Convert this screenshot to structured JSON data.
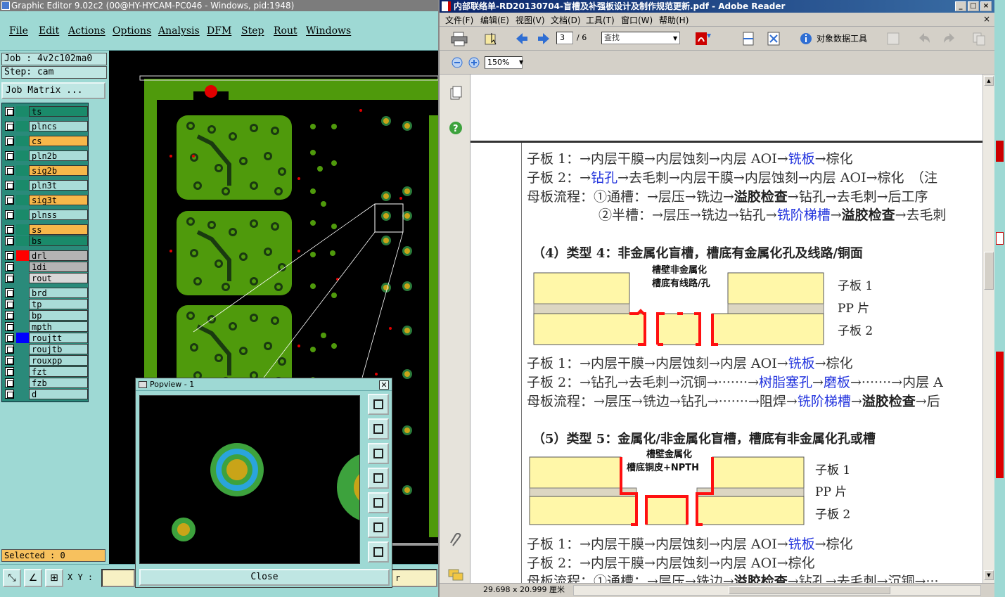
{
  "ge": {
    "title": "Graphic Editor 9.02c2 (00@HY-HYCAM-PC046 - Windows, pid:1948)",
    "menu": [
      "File",
      "Edit",
      "Actions",
      "Options",
      "Analysis",
      "DFM",
      "Step",
      "Rout",
      "Windows"
    ],
    "job_label": "Job : 4v2c102ma0",
    "step_label": "Step: cam",
    "job_matrix_label": "Job Matrix ...",
    "layers": [
      {
        "name": "ts",
        "color": "#1a8a6a"
      },
      {
        "name": "plncs",
        "color": "#a9dcd8"
      },
      {
        "name": "cs",
        "color": "#f7b74a"
      },
      {
        "name": "pln2b",
        "color": "#a9dcd8"
      },
      {
        "name": "sig2b",
        "color": "#f7b74a"
      },
      {
        "name": "pln3t",
        "color": "#a9dcd8"
      },
      {
        "name": "sig3t",
        "color": "#f7b74a"
      },
      {
        "name": "plnss",
        "color": "#a9dcd8"
      },
      {
        "name": "ss",
        "color": "#f7b74a"
      },
      {
        "name": "bs",
        "color": "#1a8a6a"
      },
      {
        "name": "drl",
        "color": "#b4b4b4"
      },
      {
        "name": "1di",
        "color": "#b4b4b4"
      },
      {
        "name": "rout",
        "color": "#d8d8d8"
      },
      {
        "name": "brd",
        "color": "#a9dcd8"
      },
      {
        "name": "tp",
        "color": "#a9dcd8"
      },
      {
        "name": "bp",
        "color": "#a9dcd8"
      },
      {
        "name": "mpth",
        "color": "#a9dcd8"
      },
      {
        "name": "roujtt",
        "color": "#a9dcd8"
      },
      {
        "name": "roujtb",
        "color": "#a9dcd8"
      },
      {
        "name": "rouxpp",
        "color": "#a9dcd8"
      },
      {
        "name": "fzt",
        "color": "#a9dcd8"
      },
      {
        "name": "fzb",
        "color": "#a9dcd8"
      },
      {
        "name": "d",
        "color": "#a9dcd8"
      }
    ],
    "selected_label": "Selected : 0",
    "xy_label": "X Y :",
    "xy_right": "r",
    "popview": {
      "title": "Popview - 1",
      "close_label": "Close",
      "close_x": "✕"
    }
  },
  "ar": {
    "title": "内部联络单-RD20130704-盲槽及补强板设计及制作规范更新.pdf - Adobe Reader",
    "menu": [
      "文件(F)",
      "编辑(E)",
      "视图(V)",
      "文档(D)",
      "工具(T)",
      "窗口(W)",
      "帮助(H)"
    ],
    "page_current": "3",
    "page_total": "/ 6",
    "find_placeholder": "查找",
    "object_tool": "对象数据工具",
    "zoom": "150%",
    "status_size": "29.698 x 20.999 厘米",
    "doc": {
      "s1": {
        "a": "子板 1：→内层干膜→内层蚀刻→内层 AOI→",
        "b": "铣板",
        "c": "→棕化"
      },
      "s2": {
        "a": "子板 2：→",
        "b": "钻孔",
        "c": "→去毛刺→内层干膜→内层蚀刻→内层 AOI→棕化　（注"
      },
      "s3": {
        "a": "母板流程：①通槽：→层压→铣边→",
        "b": "溢胶检查",
        "c": "→钻孔→去毛刺→后工序"
      },
      "s4": {
        "a": "②半槽：→层压→铣边→钻孔→",
        "b": "铣阶梯槽",
        "c": "→",
        "d": "溢胶检查",
        "e": "→去毛刺"
      },
      "h4": "（4）类型 4：非金属化盲槽，槽底有金属化孔及线路/铜面",
      "d4_note": [
        "槽壁非金属化",
        "槽底有线路/孔"
      ],
      "d4_labels": [
        "子板 1",
        "PP 片",
        "子板 2"
      ],
      "t1": {
        "a": "子板 1：→内层干膜→内层蚀刻→内层 AOI→",
        "b": "铣板",
        "c": "→棕化"
      },
      "t2": {
        "a": "子板 2：→钻孔→去毛刺→沉铜→·······→",
        "b": "树脂塞孔",
        "c": "→",
        "d": "磨板",
        "e": "→·······→内层 A"
      },
      "t3": {
        "a": "母板流程：→层压→铣边→钻孔→·······→阻焊→",
        "b": "铣阶梯槽",
        "c": "→",
        "d": "溢胶检查",
        "e": "→后"
      },
      "h5": "（5）类型 5：金属化/非金属化盲槽，槽底有非金属化孔或槽",
      "d5_note": [
        "槽壁金属化",
        "槽底铜皮+NPTH"
      ],
      "d5_labels": [
        "子板 1",
        "PP 片",
        "子板 2"
      ],
      "u1": {
        "a": "子板 1：→内层干膜→内层蚀刻→内层 AOI→",
        "b": "铣板",
        "c": "→棕化"
      },
      "u2": {
        "a": "子板 2：→内层干膜→内层蚀刻→内层 AOI→棕化"
      },
      "u3": {
        "a": "母板流程：①通槽：→层压→铣边→",
        "b": "溢胶检查",
        "c": "→钻孔→去毛刺→沉铜→···"
      }
    }
  },
  "colors": {
    "pcb_green": "#4f9a0c",
    "pad_ring": "#2a7a3a",
    "pad_center": "#c9a418",
    "drill_red": "#e00000",
    "slot_red": "#ff1010"
  }
}
